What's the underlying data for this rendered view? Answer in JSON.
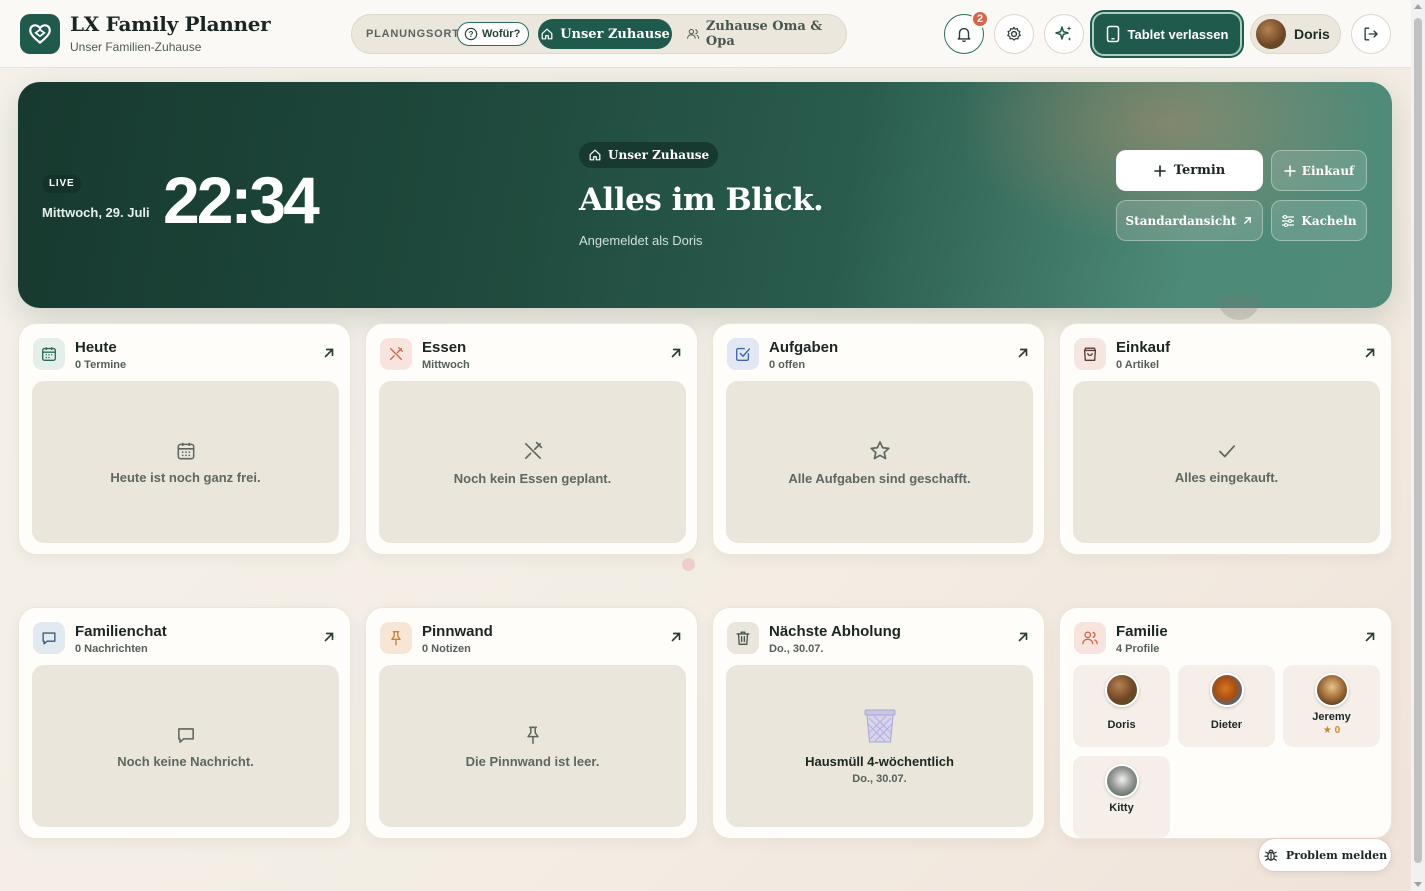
{
  "app": {
    "title": "LX Family Planner",
    "subtitle": "Unser Familien-Zuhause"
  },
  "place_switch": {
    "label": "PLANUNGSORT",
    "why_label": "Wofür?",
    "tabs": [
      {
        "label": "Unser Zuhause",
        "active": true
      },
      {
        "label": "Zuhause Oma & Opa",
        "active": false
      }
    ]
  },
  "header": {
    "notifications_count": "2",
    "tablet_button": "Tablet verlassen",
    "user_name": "Doris",
    "icons": [
      "bell-icon",
      "gear-icon",
      "sparkles-icon",
      "logout-icon"
    ]
  },
  "hero": {
    "live_label": "LIVE",
    "date": "Mittwoch, 29. Juli",
    "time": "22:34",
    "place_chip": "Unser Zuhause",
    "title": "Alles im Blick.",
    "subtitle": "Angemeldet als Doris",
    "buttons": {
      "termin": "Termin",
      "einkauf": "Einkauf",
      "standard": "Standardansicht",
      "kacheln": "Kacheln"
    }
  },
  "cards": {
    "heute": {
      "title": "Heute",
      "meta": "0 Termine",
      "empty": "Heute ist noch ganz frei."
    },
    "essen": {
      "title": "Essen",
      "meta": "Mittwoch",
      "empty": "Noch kein Essen geplant."
    },
    "aufgaben": {
      "title": "Aufgaben",
      "meta": "0 offen",
      "empty": "Alle Aufgaben sind geschafft."
    },
    "einkauf": {
      "title": "Einkauf",
      "meta": "0 Artikel",
      "empty": "Alles eingekauft."
    },
    "chat": {
      "title": "Familienchat",
      "meta": "0 Nachrichten",
      "empty": "Noch keine Nachricht."
    },
    "pinnwand": {
      "title": "Pinnwand",
      "meta": "0 Notizen",
      "empty": "Die Pinnwand ist leer."
    },
    "abholung": {
      "title": "Nächste Abholung",
      "meta": "Do., 30.07.",
      "waste_type": "Hausmüll 4-wöchentlich",
      "waste_date": "Do., 30.07."
    },
    "familie": {
      "title": "Familie",
      "meta": "4 Profile",
      "members": [
        {
          "name": "Doris",
          "stars": ""
        },
        {
          "name": "Dieter",
          "stars": ""
        },
        {
          "name": "Jeremy",
          "stars": "0"
        },
        {
          "name": "Kitty",
          "stars": ""
        }
      ]
    }
  },
  "report_button": "Problem melden",
  "colors": {
    "brand": "#1f5a4c",
    "accent_badge": "#d9634b",
    "background": "#f5f1ea"
  }
}
